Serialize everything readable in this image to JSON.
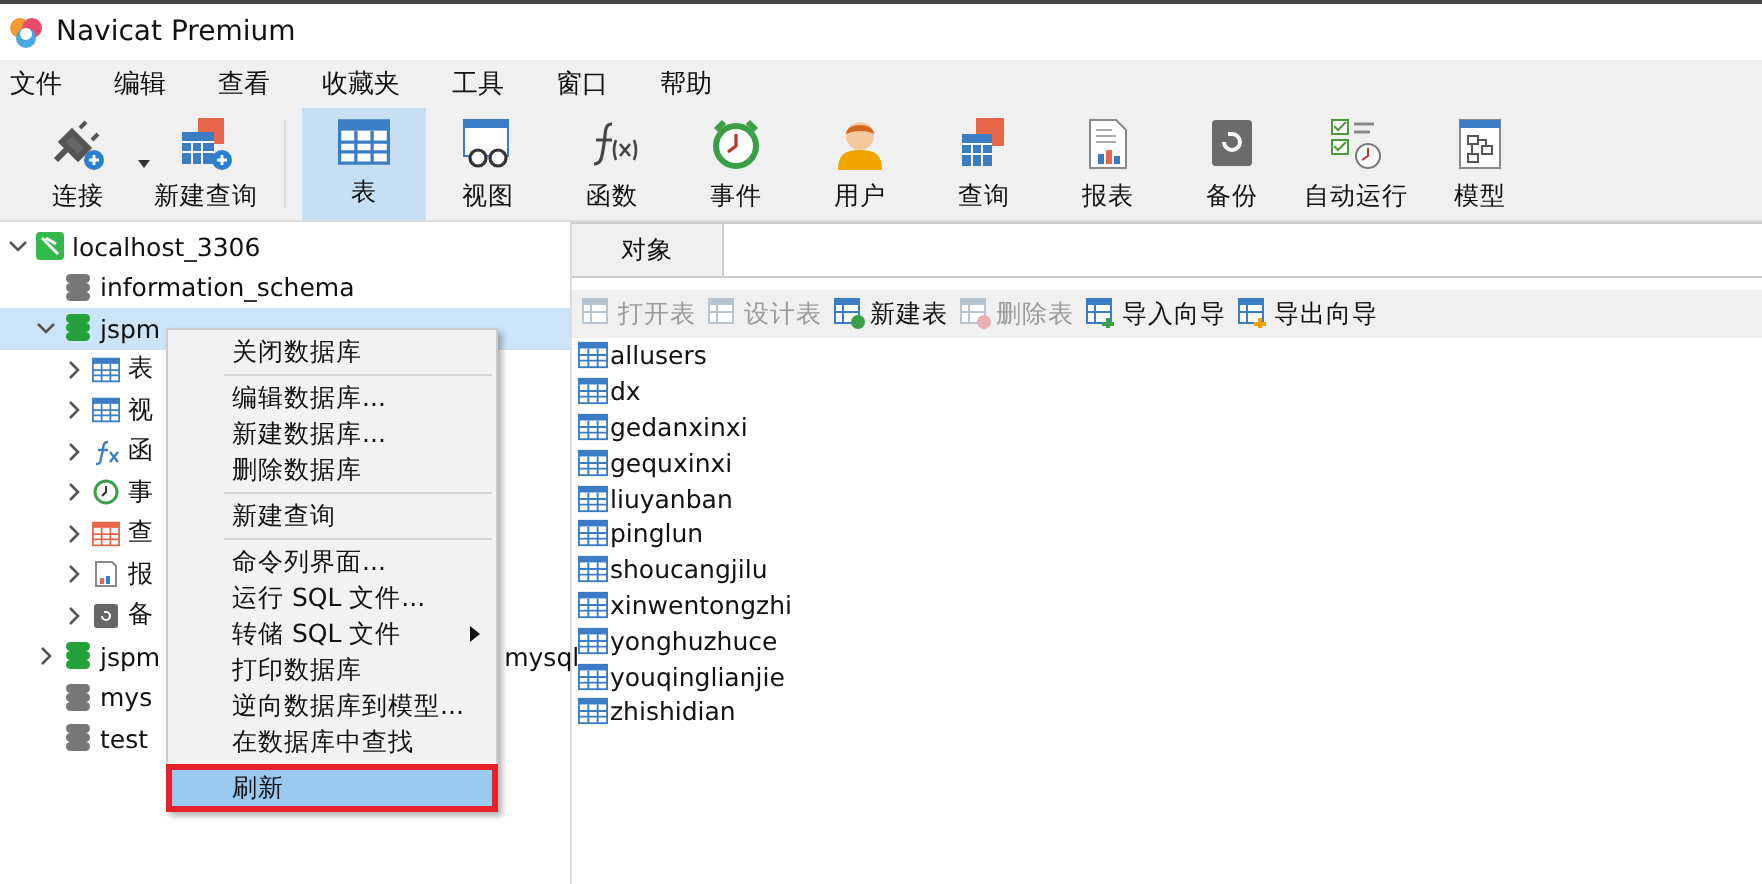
{
  "window": {
    "title": "Navicat Premium"
  },
  "menu_bar": [
    "文件",
    "编辑",
    "查看",
    "收藏夹",
    "工具",
    "窗口",
    "帮助"
  ],
  "toolbar": [
    {
      "label": "连接",
      "selected": false,
      "dropdown": true
    },
    {
      "label": "新建查询",
      "selected": false,
      "dropdown": false
    },
    {
      "label": "表",
      "selected": true,
      "dropdown": false
    },
    {
      "label": "视图",
      "selected": false,
      "dropdown": false
    },
    {
      "label": "函数",
      "selected": false,
      "dropdown": false
    },
    {
      "label": "事件",
      "selected": false,
      "dropdown": false
    },
    {
      "label": "用户",
      "selected": false,
      "dropdown": false
    },
    {
      "label": "查询",
      "selected": false,
      "dropdown": false
    },
    {
      "label": "报表",
      "selected": false,
      "dropdown": false
    },
    {
      "label": "备份",
      "selected": false,
      "dropdown": false
    },
    {
      "label": "自动运行",
      "selected": false,
      "dropdown": false
    },
    {
      "label": "模型",
      "selected": false,
      "dropdown": false
    }
  ],
  "tree": {
    "connection": {
      "label": "localhost_3306",
      "expanded": true
    },
    "databases": [
      {
        "head": "information_schema",
        "open": false,
        "selected": false,
        "has_children": false
      },
      {
        "head": "jspm",
        "open": true,
        "expanded": true,
        "selected": true,
        "has_children": true,
        "children": [
          "表",
          "视",
          "函",
          "事",
          "查",
          "报",
          "备"
        ]
      },
      {
        "head": "jspm",
        "tail": "mysql",
        "open": true,
        "expanded": false,
        "selected": false,
        "has_children": true
      },
      {
        "head": "mys",
        "open": false,
        "selected": false,
        "has_children": false
      },
      {
        "head": "test",
        "open": false,
        "selected": false,
        "has_children": false
      }
    ]
  },
  "context_menu": [
    [
      {
        "label": "关闭数据库",
        "submenu": false,
        "selected": false,
        "outlined": false
      }
    ],
    [
      {
        "label": "编辑数据库...",
        "submenu": false,
        "selected": false,
        "outlined": false
      },
      {
        "label": "新建数据库...",
        "submenu": false,
        "selected": false,
        "outlined": false
      },
      {
        "label": "删除数据库",
        "submenu": false,
        "selected": false,
        "outlined": false
      }
    ],
    [
      {
        "label": "新建查询",
        "submenu": false,
        "selected": false,
        "outlined": false
      }
    ],
    [
      {
        "label": "命令列界面...",
        "submenu": false,
        "selected": false,
        "outlined": false
      },
      {
        "label": "运行 SQL 文件...",
        "submenu": false,
        "selected": false,
        "outlined": false
      },
      {
        "label": "转储 SQL 文件",
        "submenu": true,
        "selected": false,
        "outlined": false
      },
      {
        "label": "打印数据库",
        "submenu": false,
        "selected": false,
        "outlined": false
      },
      {
        "label": "逆向数据库到模型...",
        "submenu": false,
        "selected": false,
        "outlined": false
      },
      {
        "label": "在数据库中查找",
        "submenu": false,
        "selected": false,
        "outlined": false
      }
    ],
    [
      {
        "label": "刷新",
        "submenu": false,
        "selected": true,
        "outlined": true
      }
    ]
  ],
  "tabs": [
    {
      "label": "对象",
      "selected": true
    }
  ],
  "object_toolbar": [
    {
      "label": "打开表",
      "disabled": true
    },
    {
      "label": "设计表",
      "disabled": true
    },
    {
      "label": "新建表",
      "disabled": false
    },
    {
      "label": "删除表",
      "disabled": true
    },
    {
      "label": "导入向导",
      "disabled": false
    },
    {
      "label": "导出向导",
      "disabled": false
    }
  ],
  "tables": [
    "allusers",
    "dx",
    "gedanxinxi",
    "gequxinxi",
    "liuyanban",
    "pinglun",
    "shoucangjilu",
    "xinwentongzhi",
    "yonghuzhuce",
    "youqinglianjie",
    "zhishidian"
  ]
}
